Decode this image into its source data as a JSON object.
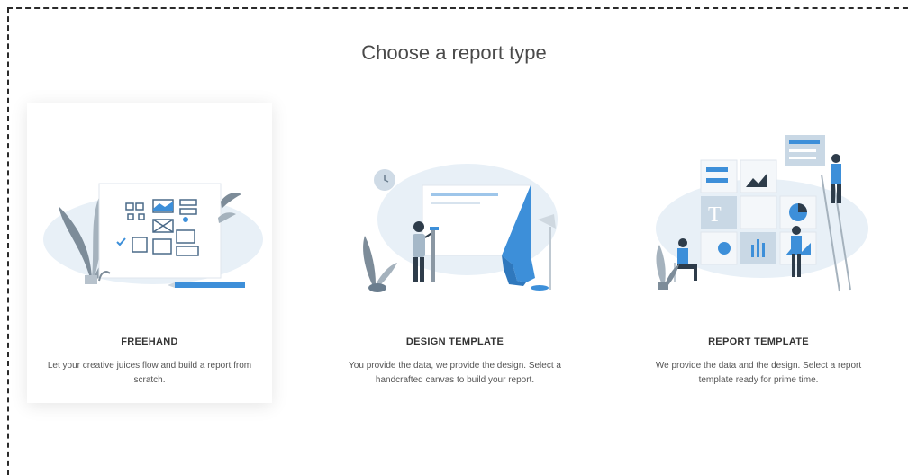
{
  "page": {
    "title": "Choose a report type"
  },
  "cards": [
    {
      "heading": "FREEHAND",
      "description": "Let your creative juices flow and build a report from scratch.",
      "icon": "freehand-illustration",
      "selected": true
    },
    {
      "heading": "DESIGN TEMPLATE",
      "description": "You provide the data, we provide the design. Select a handcrafted canvas to build your report.",
      "icon": "design-template-illustration",
      "selected": false
    },
    {
      "heading": "REPORT TEMPLATE",
      "description": "We provide the data and the design. Select a report template ready for prime time.",
      "icon": "report-template-illustration",
      "selected": false
    }
  ],
  "colors": {
    "accent": "#3d8fd9",
    "dark": "#2e3c4a",
    "light_blue": "#e6eff6",
    "text": "#4a4a4a"
  }
}
